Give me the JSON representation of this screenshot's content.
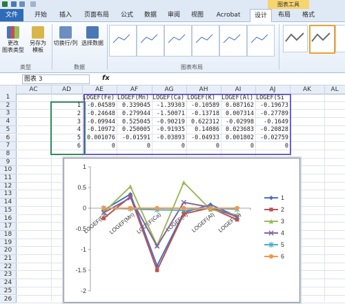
{
  "ribbon": {
    "tabs": [
      "文件",
      "开始",
      "插入",
      "页面布局",
      "公式",
      "数据",
      "审阅",
      "视图",
      "Acrobat",
      "设计",
      "布局",
      "格式"
    ],
    "context_label": "图表工具",
    "buttons": {
      "change_type": "更改\n图表类型",
      "save_template": "另存为\n模板",
      "switch_rowcol": "切换行/列",
      "select_data": "选择数据"
    },
    "groups": {
      "type": "类型",
      "data": "数据",
      "layout": "图表布局"
    }
  },
  "formula_bar": {
    "name_box": "图表 3",
    "fx": "fx"
  },
  "columns": [
    "AC",
    "AD",
    "AE",
    "AF",
    "AG",
    "AH",
    "AI",
    "AJ",
    "AK",
    "AL"
  ],
  "rows": [
    "1",
    "2",
    "3",
    "4",
    "5",
    "6",
    "7",
    "8",
    "9",
    "10",
    "11",
    "12",
    "13",
    "14",
    "15",
    "16",
    "17",
    "18",
    "19",
    "20",
    "21",
    "22",
    "23",
    "24",
    "25",
    "26"
  ],
  "table": {
    "headers": [
      "LOGEF(Fe)",
      "LOGEF(Mn)",
      "LOGEF(Ca)",
      "LOGEF(K)",
      "LOGEF(Al)",
      "LOGEF(Si"
    ],
    "row_labels": [
      "1",
      "2",
      "3",
      "4",
      "5",
      "6"
    ],
    "cells": [
      [
        "-0.04589",
        "0.339045",
        "-1.39303",
        "-0.10589",
        "0.087162",
        "-0.19673"
      ],
      [
        "-0.24648",
        "0.279944",
        "-1.50071",
        "-0.13718",
        "0.007314",
        "-0.27789"
      ],
      [
        "-0.09944",
        "0.525045",
        "-0.90219",
        "0.622312",
        "-0.02998",
        "-0.1649"
      ],
      [
        "-0.10972",
        "0.250005",
        "-0.91935",
        "0.14086",
        "0.023683",
        "-0.20828"
      ],
      [
        "0.001076",
        "-0.01591",
        "-0.03893",
        "-0.04933",
        "0.001802",
        "-0.02759"
      ],
      [
        "0",
        "0",
        "0",
        "0",
        "0",
        "0"
      ]
    ]
  },
  "chart_data": {
    "type": "line",
    "categories": [
      "LOGEF(Fe)",
      "LOGEF(Mn)",
      "LOGEF(Ca)",
      "LOGEF(K)",
      "LOGEF(Al)",
      "LOGEF(Si)"
    ],
    "ylim": [
      -2,
      1
    ],
    "yticks": [
      "1",
      "0.5",
      "0",
      "-0.5",
      "-1",
      "-1.5",
      "-2"
    ],
    "legend_position": "right",
    "series": [
      {
        "name": "1",
        "color": "#4472c4",
        "marker": "diamond",
        "values": [
          -0.04589,
          0.339045,
          -1.39303,
          -0.10589,
          0.087162,
          -0.19673
        ]
      },
      {
        "name": "2",
        "color": "#c0504d",
        "marker": "square",
        "values": [
          -0.24648,
          0.279944,
          -1.50071,
          -0.13718,
          0.007314,
          -0.27789
        ]
      },
      {
        "name": "3",
        "color": "#9bbb59",
        "marker": "triangle",
        "values": [
          -0.09944,
          0.525045,
          -0.90219,
          0.622312,
          -0.02998,
          -0.1649
        ]
      },
      {
        "name": "4",
        "color": "#8064a2",
        "marker": "x",
        "values": [
          -0.10972,
          0.250005,
          -0.91935,
          0.14086,
          0.023683,
          -0.20828
        ]
      },
      {
        "name": "5",
        "color": "#4bacc6",
        "marker": "star",
        "values": [
          0.001076,
          -0.01591,
          -0.03893,
          -0.04933,
          0.001802,
          -0.02759
        ]
      },
      {
        "name": "6",
        "color": "#f79646",
        "marker": "circle",
        "values": [
          0,
          0,
          0,
          0,
          0,
          0
        ]
      }
    ]
  }
}
